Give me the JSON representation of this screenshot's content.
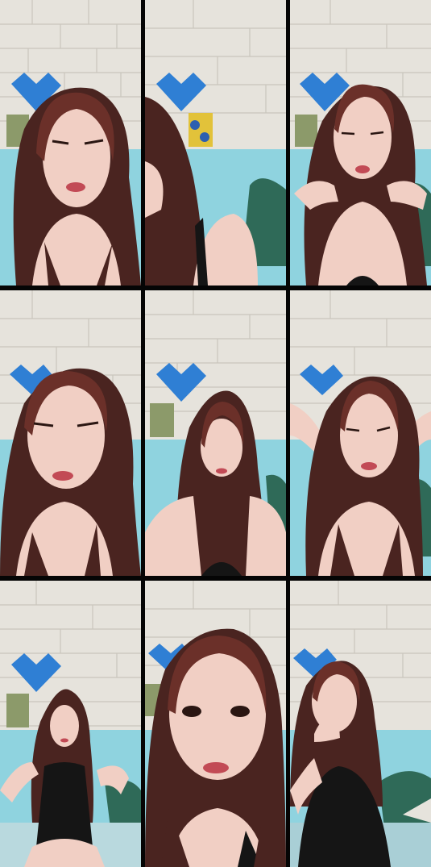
{
  "layout": {
    "columns": 3,
    "rows": 3
  },
  "palette": {
    "wall": "#e6e3dc",
    "mortar": "#c9c5bc",
    "teal_wall": "#8fd3df",
    "heart_blue": "#2f7fd4",
    "hair": "#4a2420",
    "hair_light": "#6b3029",
    "skin": "#f1cfc4",
    "skin_shadow": "#dfaea0",
    "top_black": "#151515",
    "lips": "#c24a55",
    "pillow": "#2f6a58",
    "frame_bg": "#050505"
  },
  "frames": [
    {
      "pose": "close-up-left"
    },
    {
      "pose": "partial-right-edge"
    },
    {
      "pose": "hands-on-neck"
    },
    {
      "pose": "close-up-center"
    },
    {
      "pose": "mid-shot"
    },
    {
      "pose": "hands-behind-head"
    },
    {
      "pose": "wide-gesturing"
    },
    {
      "pose": "extreme-close-up"
    },
    {
      "pose": "hand-to-mouth"
    }
  ]
}
